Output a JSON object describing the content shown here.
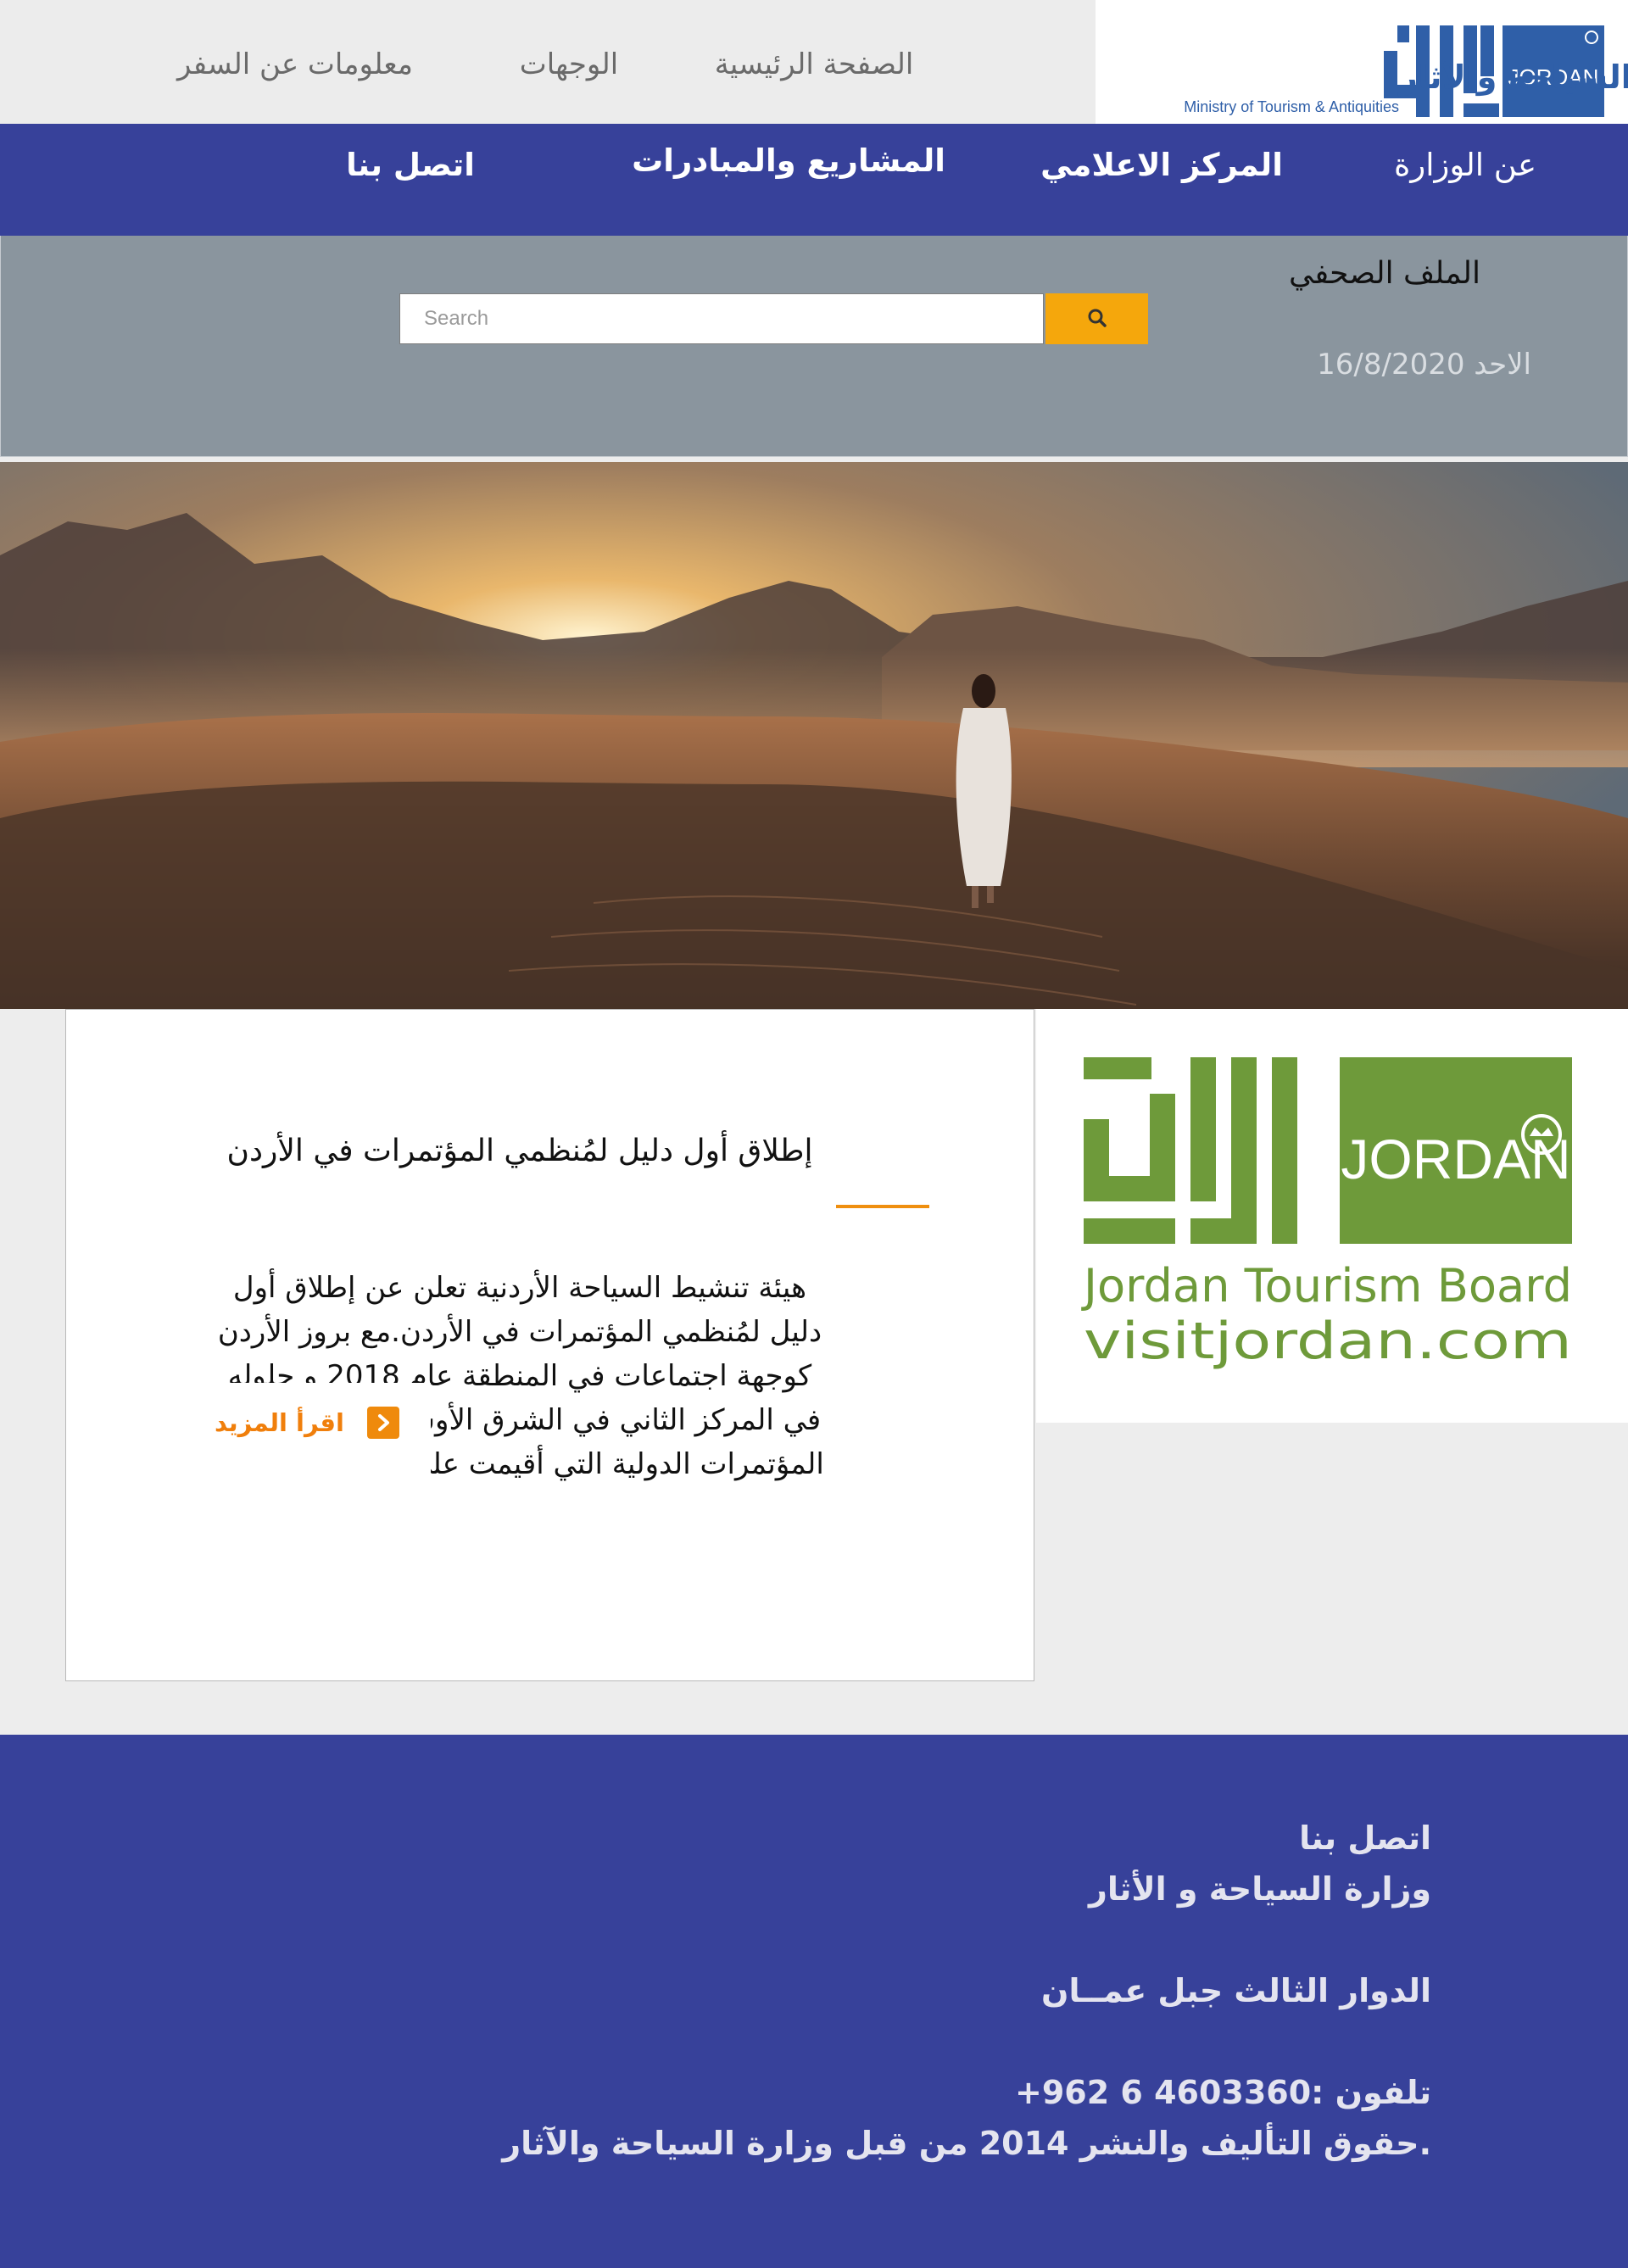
{
  "header": {
    "logo": {
      "arabic_text": "وزارة السياحة والآثار",
      "english_text": "Ministry of Tourism & Antiquities",
      "badge_text": "JORDAN"
    },
    "top_links": [
      {
        "label": "الصفحة الرئيسية"
      },
      {
        "label": "الوجهات"
      },
      {
        "label": "معلومات عن السفر"
      }
    ]
  },
  "nav": {
    "items": [
      {
        "label": "عن الوزارة"
      },
      {
        "label": "المركز الاعلامي"
      },
      {
        "label": "المشاريع والمبادرات"
      },
      {
        "label": "اتصل بنا"
      }
    ]
  },
  "search": {
    "section_title": "الملف الصحفي",
    "placeholder": "Search",
    "date": "الاحد 16/8/2020"
  },
  "hero": {
    "icon": "desert-landscape-photo"
  },
  "news": {
    "title": "إطلاق أول دليل لمُنظمي المؤتمرات في الأردن",
    "excerpt": "هيئة تنشيط السياحة الأردنية تعلن عن إطلاق أول دليل لمُنظمي المؤتمرات في الأردن.مع بروز الأردن كوجهة اجتماعات في المنطقة عام 2018 و حلوله في المركز الثاني في الشرق الأوسط من حيث عدد المؤتمرات الدولية التي أقيمت على أرضه، و بحسب إحصائيات",
    "read_more": "اقرأ المزيد"
  },
  "jtb": {
    "arabic_logo_text": "الأردن",
    "badge_text": "JORDAN",
    "line1": "Jordan Tourism Board",
    "line2": "visitjordan.com"
  },
  "footer": {
    "contact_title": "اتصل بنا",
    "org": "وزارة السياحة و الأثار",
    "address": "الدوار الثالث جبل عمــان",
    "phone": "تلفون :4603360 6 962+",
    "copyright": ".حقوق التأليف والنشر 2014 من قبل وزارة السياحة والآثار"
  },
  "colors": {
    "nav_blue": "#37419a",
    "accent_orange": "#f5a70c",
    "jtb_green": "#6e9a3a",
    "logo_blue": "#2f5fa8",
    "search_band": "#8a959e"
  }
}
